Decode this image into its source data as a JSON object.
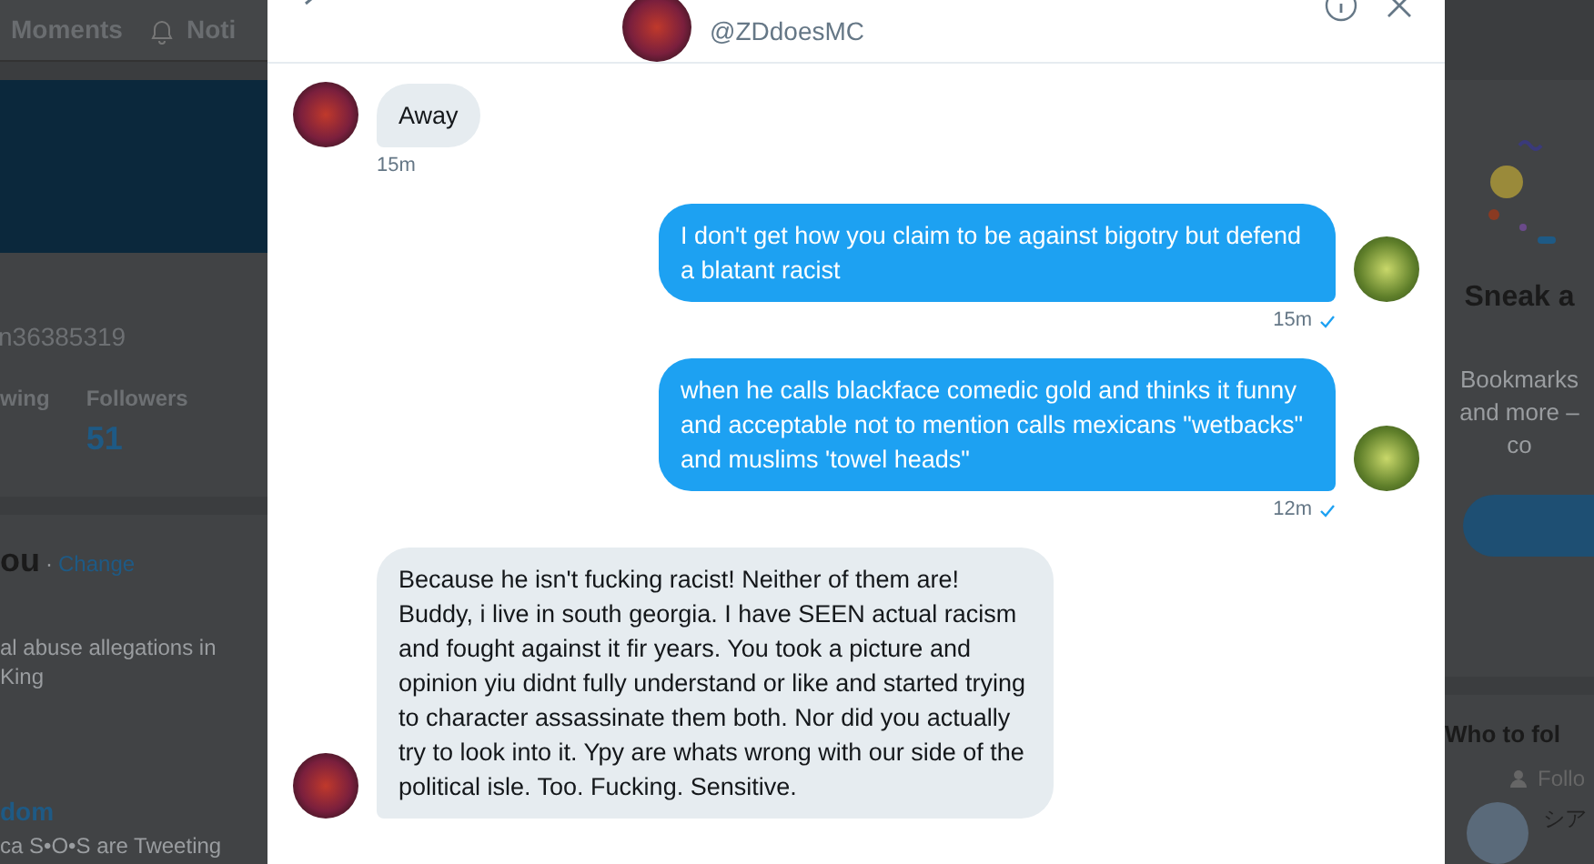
{
  "nav": {
    "items": [
      {
        "kind": "text",
        "label": "Moments"
      },
      {
        "kind": "bell",
        "label": "Noti"
      }
    ]
  },
  "profile": {
    "handle": "n36385319",
    "stats": [
      {
        "label": "wing"
      },
      {
        "label": "Followers",
        "value": "51"
      }
    ]
  },
  "trends": {
    "title": "ou",
    "separator": "·",
    "change_link": "Change",
    "items": [
      {
        "lines": [
          "al abuse allegations in",
          "King"
        ]
      },
      {
        "title": "dom",
        "lines": [
          "ca S•O•S are Tweeting"
        ]
      }
    ]
  },
  "conversation": {
    "handle": "@ZDdoesMC",
    "messages": [
      {
        "kind": "received",
        "text": "Away",
        "time": "15m"
      },
      {
        "kind": "sent",
        "text": "I don't get how you claim to be against bigotry but defend a blatant racist",
        "time": "15m",
        "delivered": true
      },
      {
        "kind": "sent",
        "text": "when he calls blackface comedic gold and thinks it funny and acceptable not to mention calls mexicans \"wetbacks\" and muslims 'towel heads\"",
        "time": "12m",
        "delivered": true
      },
      {
        "kind": "received",
        "text": "Because he isn't fucking racist! Neither of them are! Buddy, i live in south georgia. I have SEEN actual racism and fought against it fir years. You took a picture and opinion yiu didnt fully understand or like and started trying to character assassinate them both. Nor did you actually try to look into it. Ypy are whats wrong with our side of the political isle. Too. Fucking. Sensitive."
      }
    ]
  },
  "promo": {
    "title": "Sneak a",
    "body_lines": [
      "Bookmarks",
      "and more –",
      "co"
    ]
  },
  "who_to_follow": {
    "title": "Who to fol",
    "hint": "Follo",
    "account": "シア"
  }
}
